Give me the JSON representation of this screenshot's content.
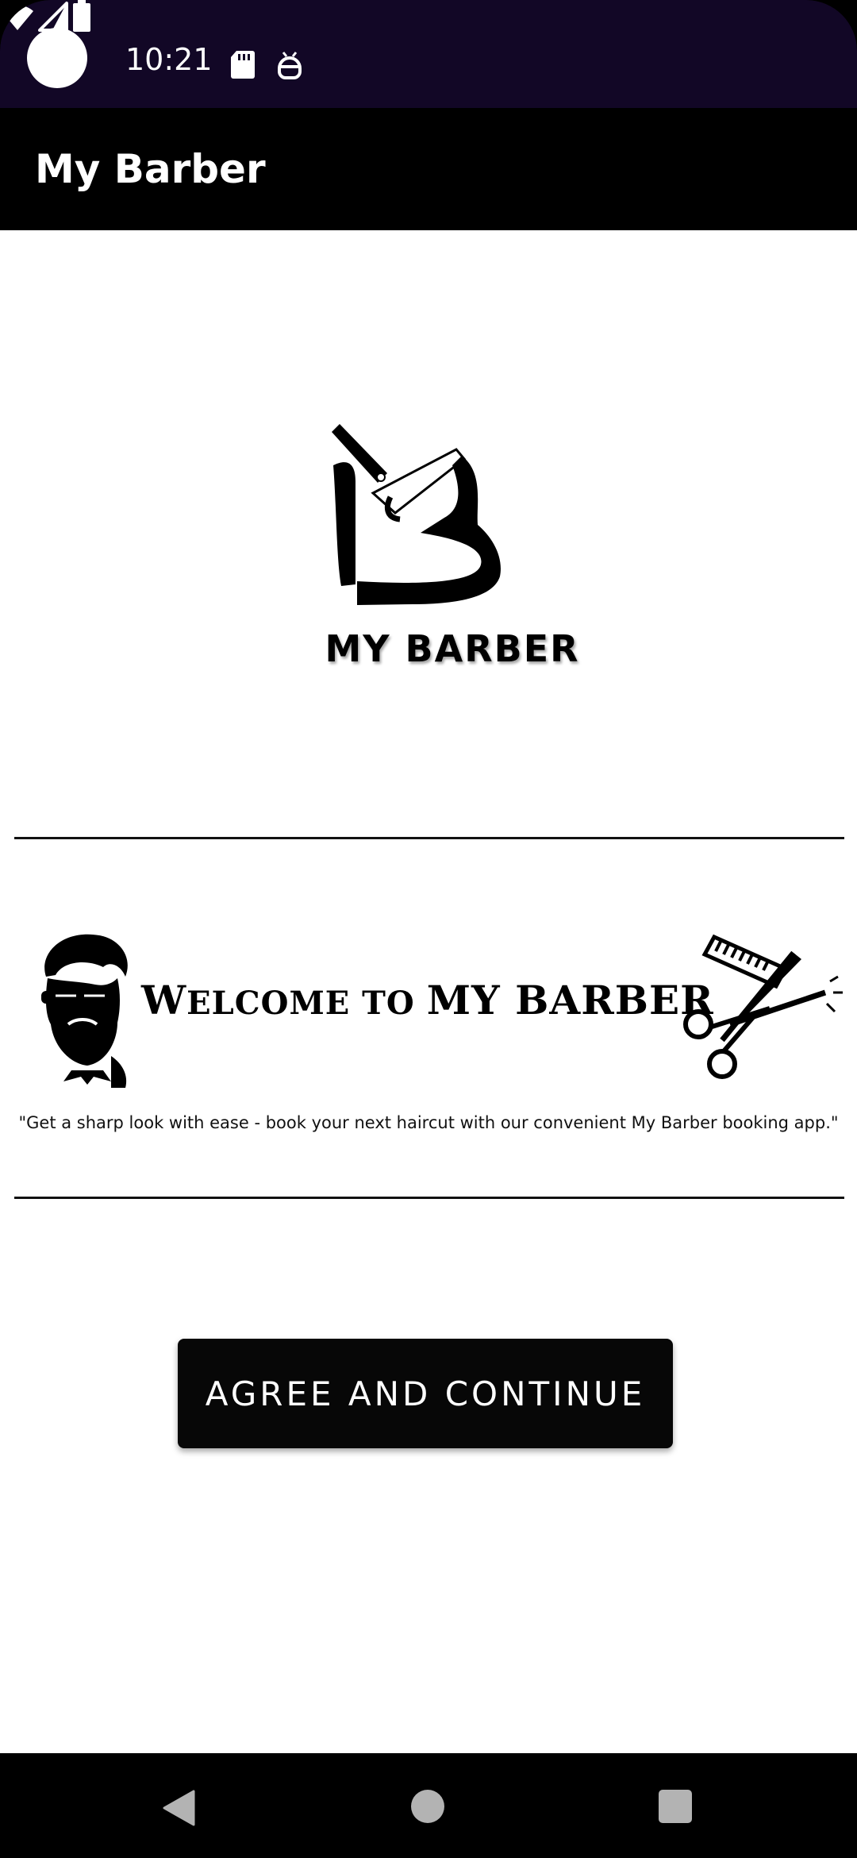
{
  "status_bar": {
    "time": "10:21",
    "icons": [
      "camera-cutout",
      "sd-card-icon",
      "debug-icon",
      "wifi-icon",
      "signal-icon",
      "battery-icon"
    ]
  },
  "app_bar": {
    "title": "My Barber"
  },
  "logo": {
    "brand_text": "MY BARBER"
  },
  "welcome_banner": {
    "heading_part1": "W",
    "heading_part2": "ELCOME TO ",
    "heading_part3": "MY BARBER",
    "tagline": "\"Get a sharp look with ease - book your next haircut with our convenient My Barber booking app.\""
  },
  "actions": {
    "agree_label": "AGREE AND CONTINUE"
  },
  "nav_bar": {
    "buttons": [
      "back",
      "home",
      "recents"
    ]
  },
  "colors": {
    "status_bar_bg": "#120726",
    "app_bar_bg": "#000000",
    "button_bg": "#070707",
    "content_bg": "#ffffff"
  }
}
